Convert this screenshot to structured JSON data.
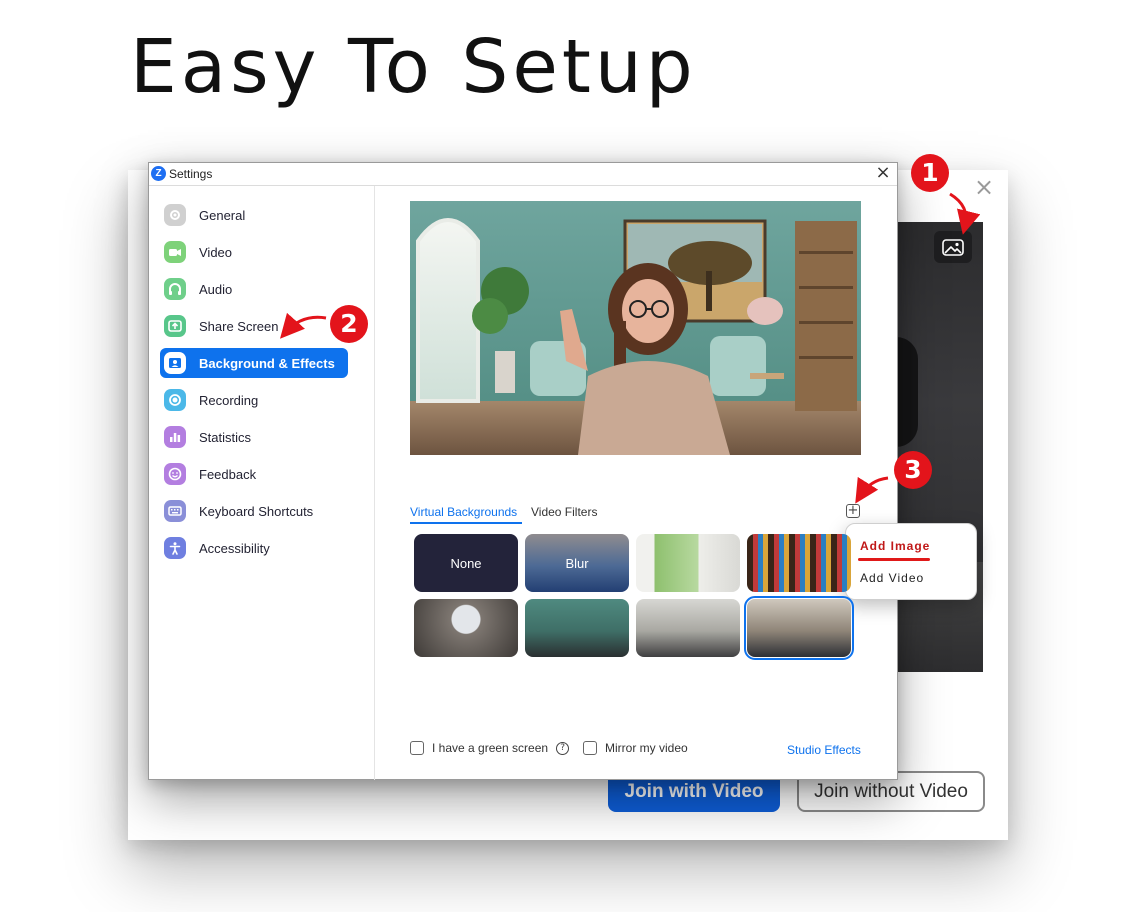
{
  "headline": "Easy To Setup",
  "background_window": {
    "join_with_video": "Join with Video",
    "join_without_video": "Join without Video",
    "close_glyph": "×"
  },
  "settings": {
    "title": "Settings",
    "logo_glyph": "Z",
    "close_glyph": "×",
    "nav": [
      {
        "label": "General",
        "icon": "gear-icon",
        "color": "#d0d0d0"
      },
      {
        "label": "Video",
        "icon": "video-camera-icon",
        "color": "#7ed27a"
      },
      {
        "label": "Audio",
        "icon": "headphones-icon",
        "color": "#6fcf8a"
      },
      {
        "label": "Share Screen",
        "icon": "share-screen-icon",
        "color": "#58c68a"
      },
      {
        "label": "Background & Effects",
        "icon": "person-portrait-icon",
        "color": "#ffffff"
      },
      {
        "label": "Recording",
        "icon": "recording-icon",
        "color": "#4bb8e8"
      },
      {
        "label": "Statistics",
        "icon": "bar-chart-icon",
        "color": "#b37ee0"
      },
      {
        "label": "Feedback",
        "icon": "smiley-icon",
        "color": "#b37ee0"
      },
      {
        "label": "Keyboard Shortcuts",
        "icon": "keyboard-icon",
        "color": "#8a8fd8"
      },
      {
        "label": "Accessibility",
        "icon": "accessibility-icon",
        "color": "#6f7fe0"
      }
    ],
    "active_nav": "Background & Effects",
    "tabs": {
      "virtual_backgrounds": "Virtual Backgrounds",
      "video_filters": "Video Filters"
    },
    "add_menu": {
      "plus_glyph": "+",
      "add_image": "Add Image",
      "add_video": "Add Video"
    },
    "thumbnails": [
      {
        "label": "None"
      },
      {
        "label": "Blur"
      },
      {
        "label": ""
      },
      {
        "label": ""
      },
      {
        "label": ""
      },
      {
        "label": ""
      },
      {
        "label": ""
      },
      {
        "label": ""
      }
    ],
    "green_screen_label": "I have a green screen",
    "help_glyph": "?",
    "mirror_label": "Mirror my video",
    "studio_effects": "Studio Effects"
  },
  "badges": [
    "1",
    "2",
    "3"
  ],
  "colors": {
    "accent": "#0e72ed",
    "badge": "#e3141b",
    "join_button": "#0e5ed8"
  }
}
